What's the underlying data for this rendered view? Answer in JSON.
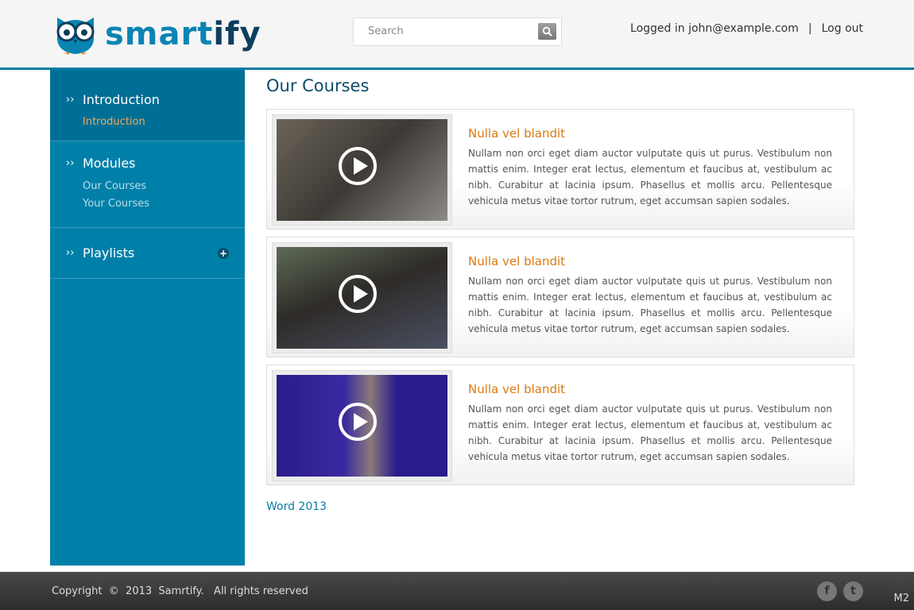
{
  "header": {
    "logo_text_a": "smart",
    "logo_text_b": "ify",
    "search_placeholder": "Search",
    "logged_in": "Logged in john@example.com",
    "separator": "|",
    "logout": "Log out"
  },
  "sidebar": {
    "sections": [
      {
        "title": "Introduction",
        "items": [
          "Introduction"
        ]
      },
      {
        "title": "Modules",
        "items": [
          "Our Courses",
          "Your Courses"
        ]
      },
      {
        "title": "Playlists",
        "items": []
      }
    ],
    "chevron": "››",
    "plus": "+"
  },
  "main": {
    "title": "Our Courses",
    "courses": [
      {
        "title": "Nulla vel blandit",
        "desc": "Nullam non orci eget diam auctor vulputate quis ut purus. Vestibulum non mattis enim. Integer erat lectus, elementum et faucibus at, vestibulum ac nibh. Curabitur at lacinia ipsum. Phasellus et mollis arcu. Pellentesque vehicula metus vitae tortor rutrum, eget accumsan sapien sodales."
      },
      {
        "title": "Nulla vel blandit",
        "desc": "Nullam non orci eget diam auctor vulputate quis ut purus. Vestibulum non mattis enim. Integer erat lectus, elementum et faucibus at, vestibulum ac nibh. Curabitur at lacinia ipsum. Phasellus et mollis arcu. Pellentesque vehicula metus vitae tortor rutrum, eget accumsan sapien sodales."
      },
      {
        "title": "Nulla vel blandit",
        "desc": "Nullam non orci eget diam auctor vulputate quis ut purus. Vestibulum non mattis enim. Integer erat lectus, elementum et faucibus at, vestibulum ac nibh. Curabitur at lacinia ipsum. Phasellus et mollis arcu. Pellentesque vehicula metus vitae tortor rutrum, eget accumsan sapien sodales."
      }
    ],
    "link": "Word 2013"
  },
  "footer": {
    "copyright": "Copyright  ©  2013  Samrtify.   All rights reserved",
    "facebook": "f",
    "twitter": "t",
    "corner": "M2"
  }
}
